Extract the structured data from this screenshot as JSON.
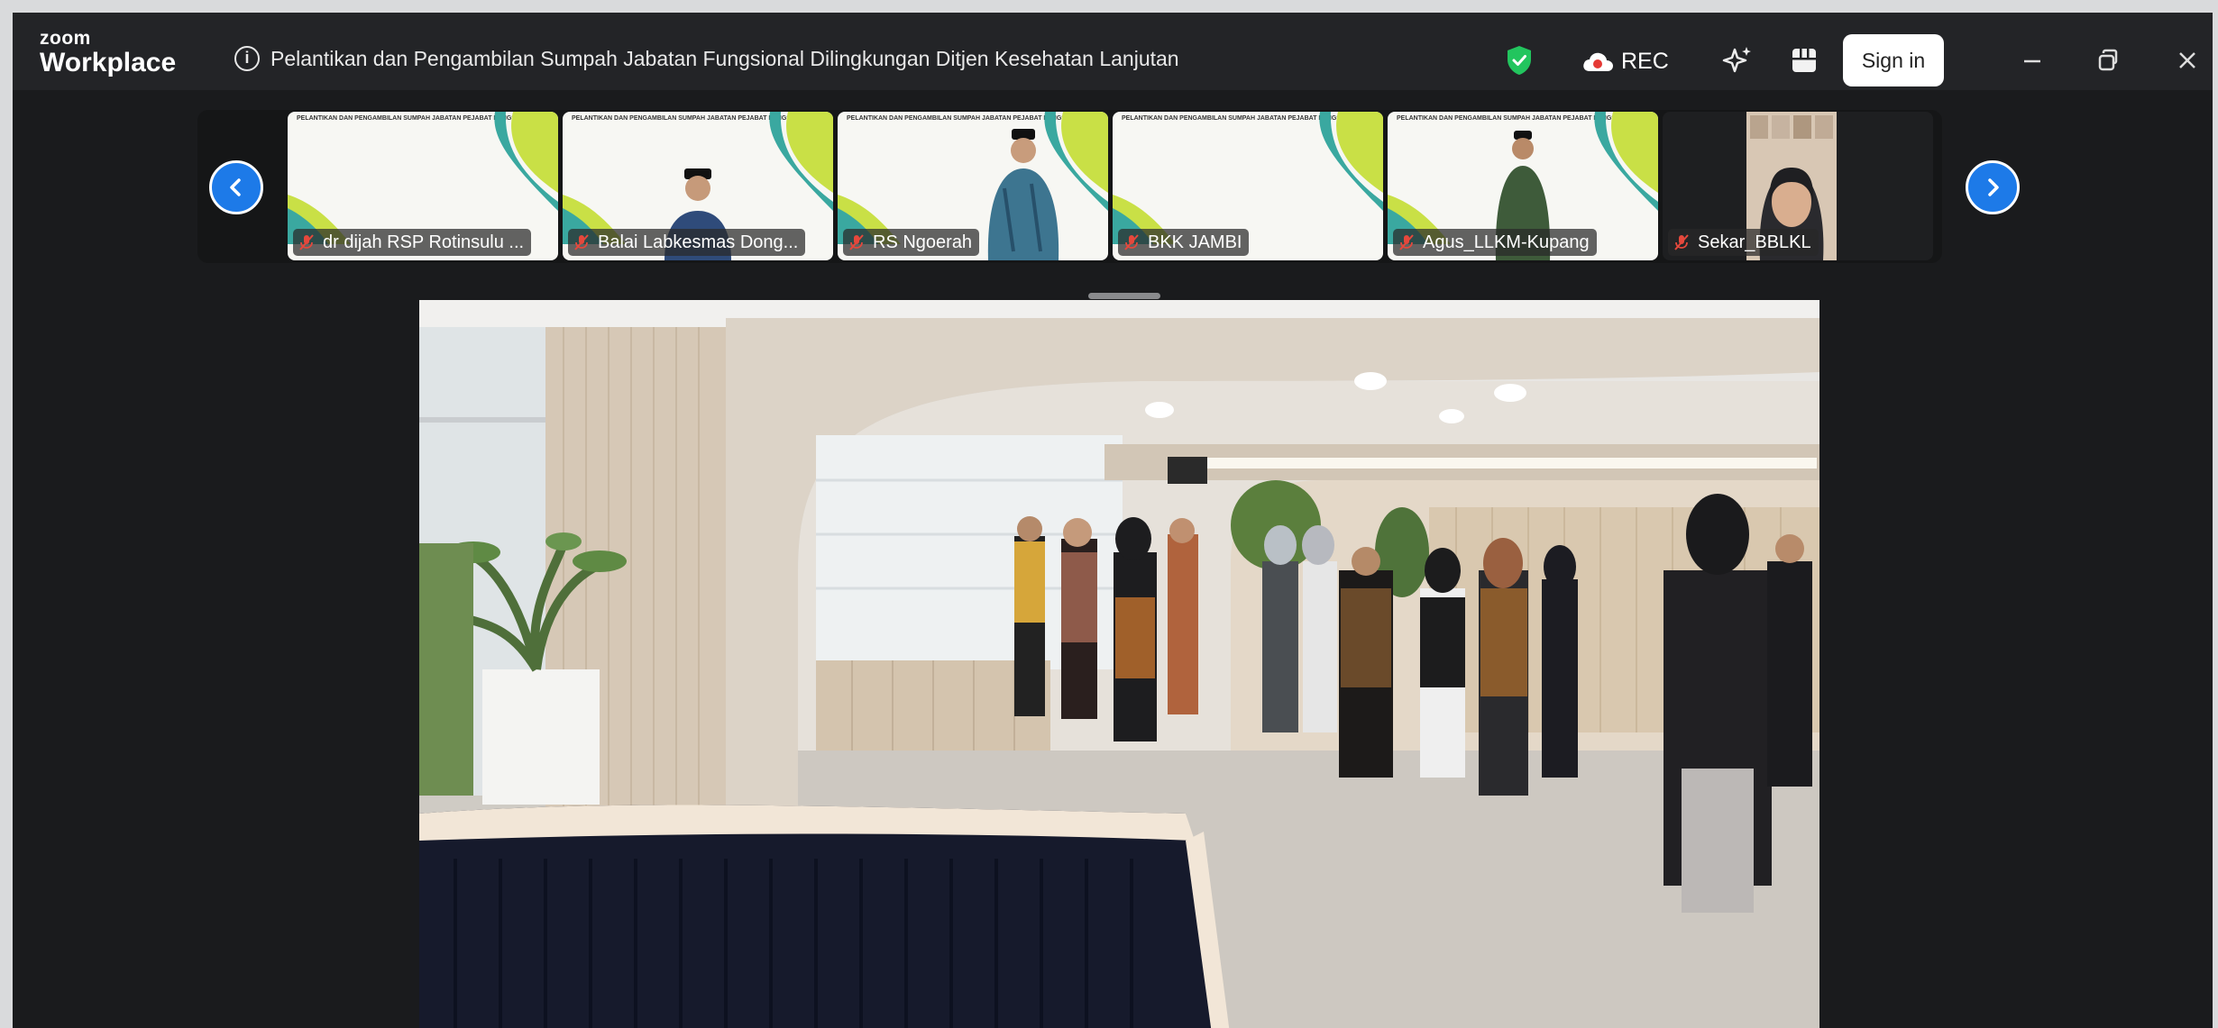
{
  "app": {
    "logo_line1": "zoom",
    "logo_line2": "Workplace",
    "meeting_title": "Pelantikan dan Pengambilan Sumpah Jabatan Fungsional Dilingkungan Ditjen Kesehatan Lanjutan",
    "rec_label": "REC",
    "signin_label": "Sign in"
  },
  "colors": {
    "titlebar": "#232427",
    "accent_blue": "#1d7ae8",
    "shield_green": "#22c55e",
    "rec_red": "#e53935",
    "mic_muted": "#e5483c"
  },
  "icons": {
    "info": "info-icon",
    "security": "shield-check-icon",
    "record": "cloud-record-icon",
    "ai": "sparkle-icon",
    "apps": "apps-grid-icon",
    "minimize": "minimize-icon",
    "restore": "restore-icon",
    "close": "close-icon",
    "prev": "chevron-left-icon",
    "next": "chevron-right-icon",
    "mic": "mic-muted-icon"
  },
  "slide_heading": "PELANTIKAN DAN PENGAMBILAN SUMPAH JABATAN PEJABAT FUNGSIONAL",
  "participants": [
    {
      "name": "dr dijah RSP Rotinsulu ..."
    },
    {
      "name": "Balai Labkesmas Dong..."
    },
    {
      "name": "RS Ngoerah"
    },
    {
      "name": "BKK JAMBI"
    },
    {
      "name": "Agus_LLKM-Kupang"
    },
    {
      "name": "Sekar_BBLKL"
    }
  ]
}
